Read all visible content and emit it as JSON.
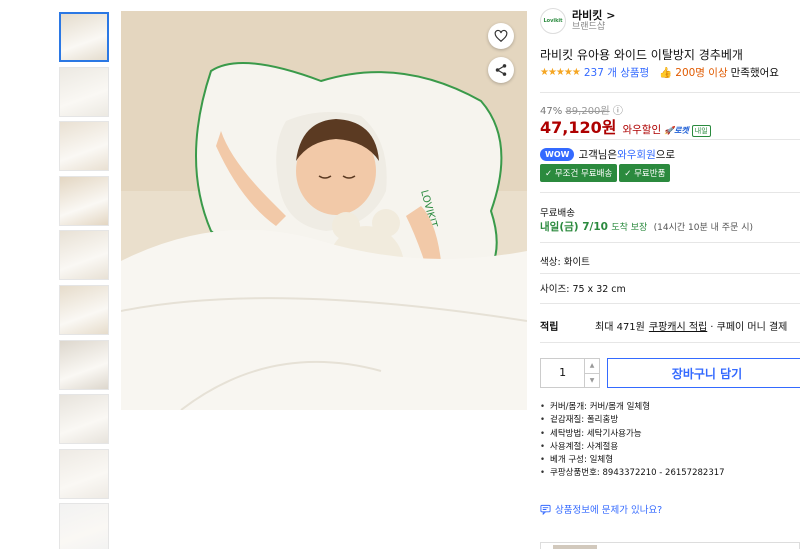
{
  "thumbnails": [
    {
      "name": "thumb-1",
      "color": "#e4dccd"
    },
    {
      "name": "thumb-2",
      "color": "#ece9e2"
    },
    {
      "name": "thumb-3",
      "color": "#e9e0d2"
    },
    {
      "name": "thumb-4",
      "color": "#e3d6c2"
    },
    {
      "name": "thumb-5",
      "color": "#e8e1d5"
    },
    {
      "name": "thumb-6",
      "color": "#e6dccb"
    },
    {
      "name": "thumb-7",
      "color": "#ddd7cd"
    },
    {
      "name": "thumb-8",
      "color": "#e7e3dc"
    },
    {
      "name": "thumb-9",
      "color": "#eeeae4"
    },
    {
      "name": "thumb-10",
      "color": "#f2f2f2"
    }
  ],
  "main_image": {
    "pillow_label": "LOVIKIT",
    "icons": {
      "wishlist": "heart-icon",
      "share": "share-icon"
    }
  },
  "brand": {
    "logo_text": "Lovikit",
    "name": "라비킷",
    "arrow": ">",
    "sub": "브랜드샵"
  },
  "product": {
    "title": "라비킷 유아용 와이드 이탈방지 경추베개",
    "stars": "★★★★★",
    "review_count": "237 개 상품평",
    "thumb_icon": "👍",
    "satisfied_num": "200명 이상",
    "satisfied_text": "만족했어요"
  },
  "price": {
    "discount": "47%",
    "original": "89,200원",
    "info_icon": "ⓘ",
    "final": "47,120원",
    "wow_sale": "와우할인",
    "rocket": "🚀로켓",
    "rocket_day": "내일"
  },
  "wow": {
    "pill": "WOW",
    "text_prefix": "고객님은 ",
    "link": "와우회원",
    "text_suffix": "으로"
  },
  "benefits": [
    "✓ 무조건 무료배송",
    "✓ 무료반품"
  ],
  "shipping": {
    "label": "무료배송",
    "date": "내일(금) 7/10",
    "guarantee": "도착 보장",
    "note": "(14시간 10분 내 주문 시)"
  },
  "options": {
    "color": "색상: 화이트",
    "size": "사이즈: 75 x 32 cm"
  },
  "reward": {
    "label": "적립",
    "max": "최대 471원",
    "link": "쿠팡캐시 적립",
    "more": "· 쿠페이 머니 결제"
  },
  "purchase": {
    "quantity": "1",
    "up": "▲",
    "down": "▼",
    "cart": "장바구니 담기"
  },
  "specs": [
    "커버/몸개: 커버/몸개 일체형",
    "겉감재질: 폴리홈방",
    "세탁방법: 세탁기사용가능",
    "사용계절: 사계절용",
    "베개 구성: 일체형",
    "쿠팡상품번호: 8943372210 - 26157282317"
  ],
  "report": {
    "icon": "message-icon",
    "text": "상품정보에 문제가 있나요?"
  },
  "colors": {
    "accent": "#346aff",
    "price": "#ae0000",
    "green": "#2b8a3e",
    "star": "#f5a623",
    "selected_border": "#2b78e4"
  }
}
